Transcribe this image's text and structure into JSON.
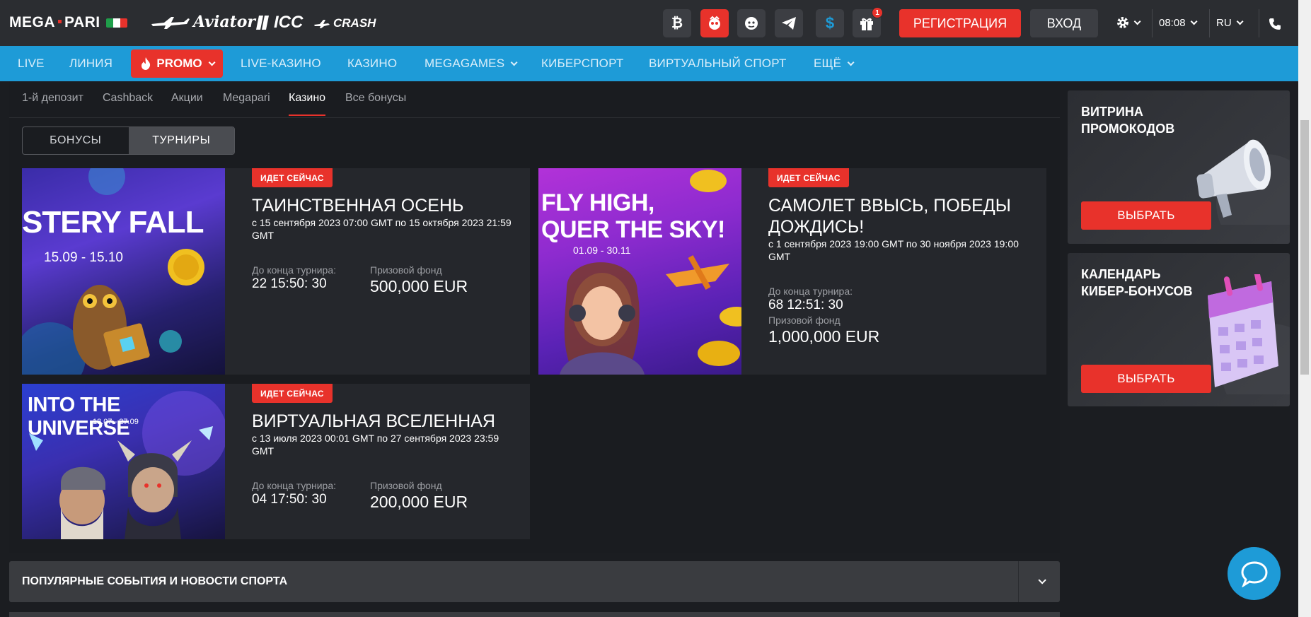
{
  "header": {
    "logo_left": "MEGA",
    "logo_right": "PARI",
    "partners": [
      "Aviator",
      "ICC",
      "CRASH"
    ],
    "gift_count": "1",
    "register_label": "РЕГИСТРАЦИЯ",
    "login_label": "ВХОД",
    "time": "08:08",
    "language": "RU"
  },
  "nav": {
    "items": [
      "LIVE",
      "ЛИНИЯ",
      "PROMO",
      "LIVE-КАЗИНО",
      "КАЗИНО",
      "MEGAGAMES",
      "КИБЕРСПОРТ",
      "ВИРТУАЛЬНЫЙ СПОРТ",
      "ЕЩЁ"
    ]
  },
  "subtabs": [
    "1-й депозит",
    "Cashback",
    "Акции",
    "Megapari",
    "Казино",
    "Все бонусы"
  ],
  "toggle": {
    "bonuses": "БОНУСЫ",
    "tournaments": "ТУРНИРЫ"
  },
  "tournaments": [
    {
      "badge": "ИДЕТ СЕЙЧАС",
      "title": "ТАИНСТВЕННАЯ ОСЕНЬ",
      "dates": "с 15 сентября 2023 07:00 GMT по 15 октября 2023 21:59 GMT",
      "ends_label": "До конца турнира:",
      "ends_value": "22 15:50: 30",
      "prize_label": "Призовой фонд",
      "prize_value": "500,000 EUR",
      "image_title": "STERY FALL",
      "image_dates": "15.09 - 15.10"
    },
    {
      "badge": "ИДЕТ СЕЙЧАС",
      "title": "САМОЛЕТ ВВЫСЬ, ПОБЕДЫ ДОЖДИСЬ!",
      "dates": "с 1 сентября 2023 19:00 GMT по 30 ноября 2023 19:00 GMT",
      "ends_label": "До конца турнира:",
      "ends_value": "68 12:51: 30",
      "prize_label": "Призовой фонд",
      "prize_value": "1,000,000 EUR",
      "image_title_1": "FLY HIGH,",
      "image_title_2": "QUER THE SKY!",
      "image_dates": "01.09 - 30.11"
    },
    {
      "badge": "ИДЕТ СЕЙЧАС",
      "title": "ВИРТУАЛЬНАЯ ВСЕЛЕННАЯ",
      "dates": "с 13 июля 2023 00:01 GMT по 27 сентября 2023 23:59 GMT",
      "ends_label": "До конца турнира:",
      "ends_value": "04 17:50: 30",
      "prize_label": "Призовой фонд",
      "prize_value": "200,000 EUR",
      "image_title": "INTO THE UNIVERSE",
      "image_dates": "13.07 - 27.09"
    }
  ],
  "popular_label": "ПОПУЛЯРНЫЕ СОБЫТИЯ И НОВОСТИ СПОРТА",
  "sidebar": {
    "promo_title": "ВИТРИНА ПРОМОКОДОВ",
    "promo_button": "ВЫБРАТЬ",
    "calendar_title": "КАЛЕНДАРЬ КИБЕР-БОНУСОВ",
    "calendar_button": "ВЫБРАТЬ"
  },
  "colors": {
    "accent": "#e8322b",
    "nav": "#1e9bd7",
    "card": "#25272c",
    "bg": "#1b1d21"
  }
}
